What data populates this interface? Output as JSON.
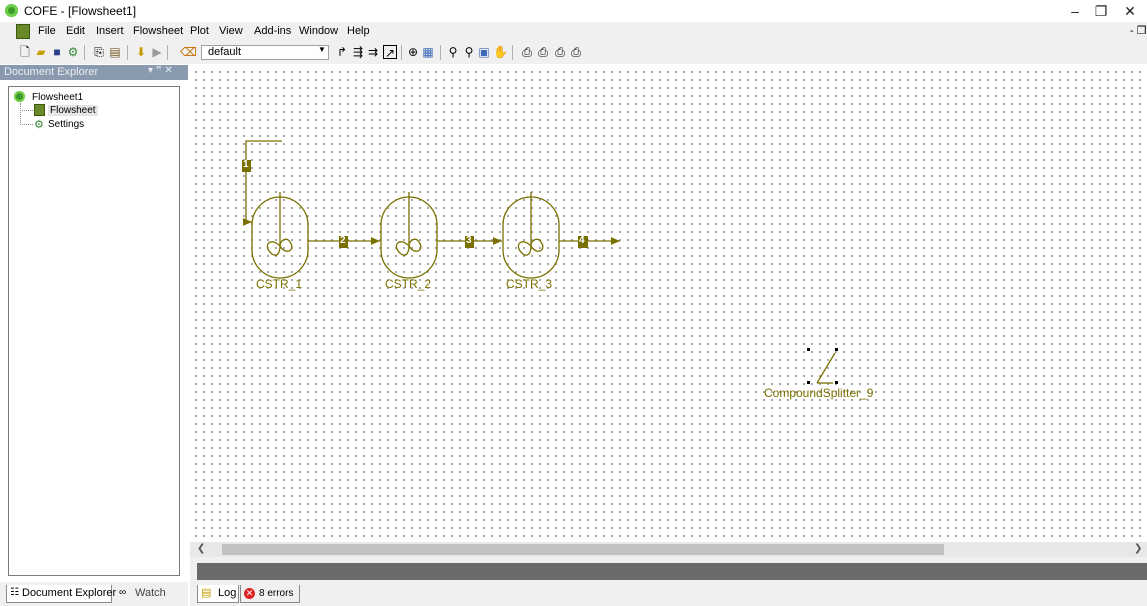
{
  "window": {
    "title": "COFE - [Flowsheet1]",
    "controls": {
      "minimize": "–",
      "restore": "❐",
      "close": "✕"
    }
  },
  "menu": {
    "items": [
      "File",
      "Edit",
      "Insert",
      "Flowsheet",
      "Plot",
      "View",
      "Add-ins",
      "Window",
      "Help"
    ],
    "mdi_restore": "- ❐"
  },
  "toolbar": {
    "combo_value": "default",
    "icons": [
      "new-icon",
      "open-icon",
      "save-icon",
      "properties-icon",
      "copy-icon",
      "paste-icon",
      "download-icon",
      "run-icon",
      "eraser-icon",
      "stream-icon",
      "split-stream-icon",
      "join-stream-icon",
      "reroute-icon",
      "unit-op-icon",
      "grid-icon",
      "zoom-in-icon",
      "zoom-out-icon",
      "zoom-fit-icon",
      "pan-icon",
      "print-icon",
      "print-preview-icon",
      "print-setup-icon",
      "export-icon"
    ]
  },
  "explorer": {
    "header": "Document Explorer",
    "header_controls": "▾ ꟸ ✕",
    "tree": [
      {
        "label": "Flowsheet1",
        "icon": "flowsheet-root-icon"
      },
      {
        "label": "Flowsheet",
        "icon": "flowsheet-icon"
      },
      {
        "label": "Settings",
        "icon": "settings-icon"
      }
    ],
    "tabs": {
      "explorer": "Document Explorer",
      "watch": "Watch"
    }
  },
  "flowsheet": {
    "units": [
      {
        "name": "CSTR_1"
      },
      {
        "name": "CSTR_2"
      },
      {
        "name": "CSTR_3"
      },
      {
        "name": "CompoundSplitter_9"
      }
    ],
    "streams": [
      "1",
      "2",
      "3",
      "4"
    ],
    "accent": "#7a7000"
  },
  "log": {
    "log_tab": "Log",
    "errors_tab": "8 errors"
  },
  "colors": {
    "panel_header": "#8a9aae",
    "error": "#dd2222"
  }
}
